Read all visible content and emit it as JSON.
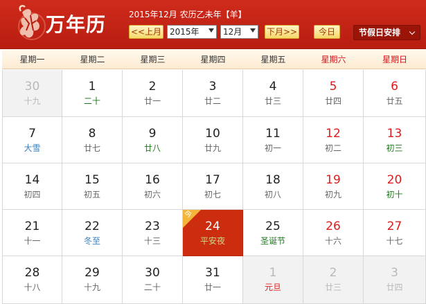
{
  "app": {
    "title": "万年历"
  },
  "header": {
    "date_line": "2015年12月 农历乙未年【羊】",
    "prev_month": "<<上月",
    "next_month": "下月>>",
    "today": "今日",
    "year_select": "2015年",
    "month_select": "12月",
    "holiday_menu": "节假日安排"
  },
  "colors": {
    "header_red": "#c4231a",
    "gold_button": "#f5d76a",
    "today_bg": "#cc2d0f",
    "weekend_red": "#e01b1b",
    "solar_term_blue": "#3581c3",
    "festival_green": "#1f7a1f"
  },
  "weekdays": [
    "星期一",
    "星期二",
    "星期三",
    "星期四",
    "星期五",
    "星期六",
    "星期日"
  ],
  "today_badge": "今",
  "weeks": [
    [
      {
        "day": "30",
        "lunar": "十九",
        "other": true
      },
      {
        "day": "1",
        "lunar": "二十",
        "lunar_style": "festival"
      },
      {
        "day": "2",
        "lunar": "廿一"
      },
      {
        "day": "3",
        "lunar": "廿二"
      },
      {
        "day": "4",
        "lunar": "廿三"
      },
      {
        "day": "5",
        "lunar": "廿四"
      },
      {
        "day": "6",
        "lunar": "廿五"
      }
    ],
    [
      {
        "day": "7",
        "lunar": "大雪",
        "lunar_style": "term"
      },
      {
        "day": "8",
        "lunar": "廿七"
      },
      {
        "day": "9",
        "lunar": "廿八",
        "lunar_style": "festival"
      },
      {
        "day": "10",
        "lunar": "廿九"
      },
      {
        "day": "11",
        "lunar": "初一"
      },
      {
        "day": "12",
        "lunar": "初二"
      },
      {
        "day": "13",
        "lunar": "初三",
        "lunar_style": "festival"
      }
    ],
    [
      {
        "day": "14",
        "lunar": "初四"
      },
      {
        "day": "15",
        "lunar": "初五"
      },
      {
        "day": "16",
        "lunar": "初六"
      },
      {
        "day": "17",
        "lunar": "初七"
      },
      {
        "day": "18",
        "lunar": "初八"
      },
      {
        "day": "19",
        "lunar": "初九"
      },
      {
        "day": "20",
        "lunar": "初十",
        "lunar_style": "festival"
      }
    ],
    [
      {
        "day": "21",
        "lunar": "十一"
      },
      {
        "day": "22",
        "lunar": "冬至",
        "lunar_style": "term"
      },
      {
        "day": "23",
        "lunar": "十三"
      },
      {
        "day": "24",
        "lunar": "平安夜",
        "today": true
      },
      {
        "day": "25",
        "lunar": "圣诞节",
        "lunar_style": "festival"
      },
      {
        "day": "26",
        "lunar": "十六"
      },
      {
        "day": "27",
        "lunar": "十七"
      }
    ],
    [
      {
        "day": "28",
        "lunar": "十八"
      },
      {
        "day": "29",
        "lunar": "十九"
      },
      {
        "day": "30",
        "lunar": "二十"
      },
      {
        "day": "31",
        "lunar": "廿一"
      },
      {
        "day": "1",
        "lunar": "元旦",
        "other": true,
        "lunar_style": "red"
      },
      {
        "day": "2",
        "lunar": "廿三",
        "other": true
      },
      {
        "day": "3",
        "lunar": "廿四",
        "other": true
      }
    ]
  ]
}
